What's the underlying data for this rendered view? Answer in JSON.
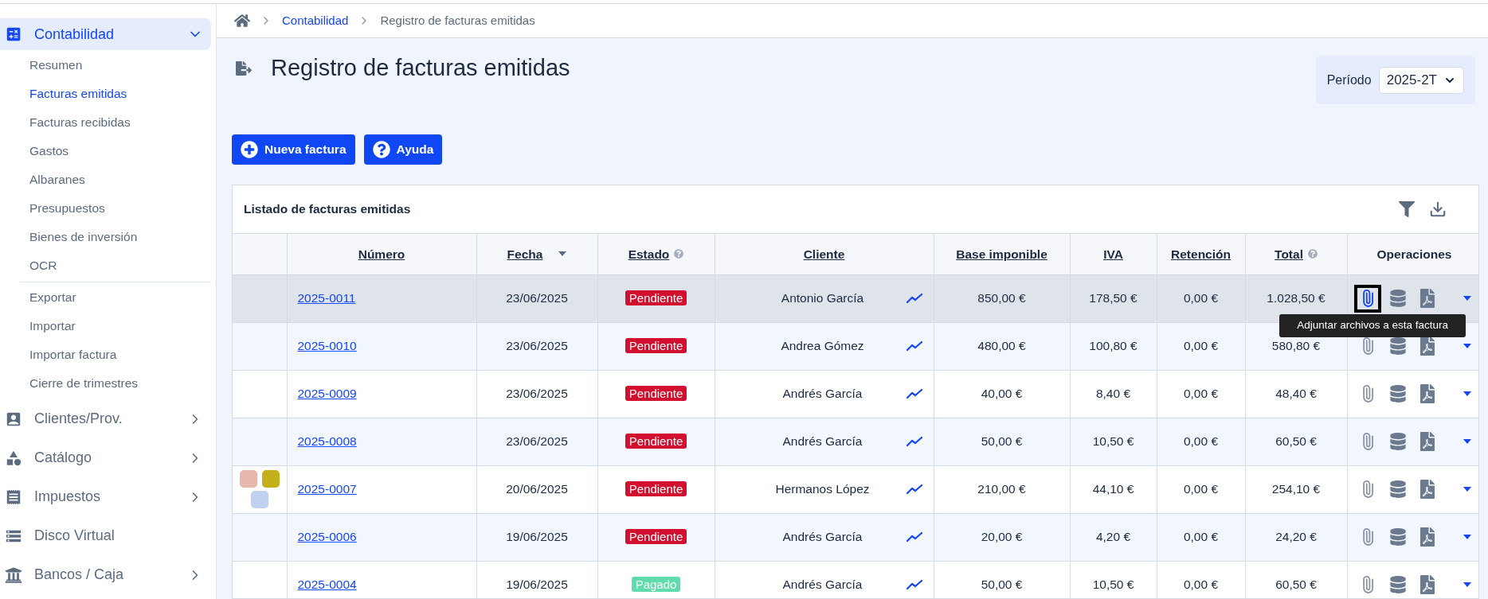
{
  "sidebar": {
    "sections": [
      {
        "label": "Contabilidad",
        "expanded": true,
        "has_children": true,
        "groups": [
          {
            "items": [
              {
                "label": "Resumen",
                "selected": false
              },
              {
                "label": "Facturas emitidas",
                "selected": true
              },
              {
                "label": "Facturas recibidas",
                "selected": false
              },
              {
                "label": "Gastos",
                "selected": false
              },
              {
                "label": "Albaranes",
                "selected": false
              },
              {
                "label": "Presupuestos",
                "selected": false
              },
              {
                "label": "Bienes de inversión",
                "selected": false
              },
              {
                "label": "OCR",
                "selected": false
              }
            ]
          },
          {
            "items": [
              {
                "label": "Exportar",
                "selected": false
              },
              {
                "label": "Importar",
                "selected": false
              },
              {
                "label": "Importar factura",
                "selected": false
              },
              {
                "label": "Cierre de trimestres",
                "selected": false
              }
            ]
          }
        ]
      },
      {
        "label": "Clientes/Prov.",
        "expanded": false,
        "has_children": true
      },
      {
        "label": "Catálogo",
        "expanded": false,
        "has_children": true
      },
      {
        "label": "Impuestos",
        "expanded": false,
        "has_children": true
      },
      {
        "label": "Disco Virtual",
        "expanded": false,
        "has_children": false
      },
      {
        "label": "Bancos / Caja",
        "expanded": false,
        "has_children": true
      }
    ]
  },
  "breadcrumb": [
    {
      "label": "Contabilidad",
      "kind": "link"
    },
    {
      "label": "Registro de facturas emitidas",
      "kind": "current"
    }
  ],
  "page_title": "Registro de facturas emitidas",
  "period": {
    "label": "Período",
    "value": "2025-2T"
  },
  "buttons": [
    {
      "label": "Nueva factura"
    },
    {
      "label": "Ayuda"
    }
  ],
  "table": {
    "title": "Listado de facturas emitidas",
    "columns": [
      {
        "label": "Número",
        "kind": "link",
        "sorted": false,
        "help": false
      },
      {
        "label": "Fecha",
        "kind": "link",
        "sorted": true,
        "help": false
      },
      {
        "label": "Estado",
        "kind": "link",
        "sorted": false,
        "help": true
      },
      {
        "label": "Cliente",
        "kind": "link",
        "sorted": false,
        "help": false
      },
      {
        "label": "Base imponible",
        "kind": "link",
        "sorted": false,
        "help": false
      },
      {
        "label": "IVA",
        "kind": "link",
        "sorted": false,
        "help": false
      },
      {
        "label": "Retención",
        "kind": "link",
        "sorted": false,
        "help": false
      },
      {
        "label": "Total",
        "kind": "link",
        "sorted": false,
        "help": true
      },
      {
        "label": "Operaciones",
        "kind": "plain",
        "sorted": false,
        "help": false
      }
    ],
    "rows": [
      {
        "number": "2025-0011",
        "date": "23/06/2025",
        "status": {
          "label": "Pendiente",
          "kind": "pending"
        },
        "client": "Antonio García",
        "base": "850,00 €",
        "iva": "178,50 €",
        "retention": "0,00 €",
        "total": "1.028,50 €",
        "selected": true,
        "attach_focused": true
      },
      {
        "number": "2025-0010",
        "date": "23/06/2025",
        "status": {
          "label": "Pendiente",
          "kind": "pending"
        },
        "client": "Andrea Gómez",
        "base": "480,00 €",
        "iva": "100,80 €",
        "retention": "0,00 €",
        "total": "580,80 €",
        "selected": false
      },
      {
        "number": "2025-0009",
        "date": "23/06/2025",
        "status": {
          "label": "Pendiente",
          "kind": "pending"
        },
        "client": "Andrés García",
        "base": "40,00 €",
        "iva": "8,40 €",
        "retention": "0,00 €",
        "total": "48,40 €",
        "selected": false
      },
      {
        "number": "2025-0008",
        "date": "23/06/2025",
        "status": {
          "label": "Pendiente",
          "kind": "pending"
        },
        "client": "Andrés García",
        "base": "50,00 €",
        "iva": "10,50 €",
        "retention": "0,00 €",
        "total": "60,50 €",
        "selected": false
      },
      {
        "number": "2025-0007",
        "date": "20/06/2025",
        "status": {
          "label": "Pendiente",
          "kind": "pending"
        },
        "client": "Hermanos López",
        "base": "210,00 €",
        "iva": "44,10 €",
        "retention": "0,00 €",
        "total": "254,10 €",
        "selected": false,
        "tags": [
          {
            "color": "#e6b8ad"
          },
          {
            "color": "#c4b018"
          },
          {
            "color": "#c0d0f0"
          }
        ]
      },
      {
        "number": "2025-0006",
        "date": "19/06/2025",
        "status": {
          "label": "Pendiente",
          "kind": "pending"
        },
        "client": "Andrés García",
        "base": "20,00 €",
        "iva": "4,20 €",
        "retention": "0,00 €",
        "total": "24,20 €",
        "selected": false
      },
      {
        "number": "2025-0004",
        "date": "19/06/2025",
        "status": {
          "label": "Pagado",
          "kind": "paid"
        },
        "client": "Andrés García",
        "base": "50,00 €",
        "iva": "10,50 €",
        "retention": "0,00 €",
        "total": "60,50 €",
        "selected": false
      }
    ]
  },
  "tooltip": {
    "text": "Adjuntar archivos a esta factura"
  }
}
